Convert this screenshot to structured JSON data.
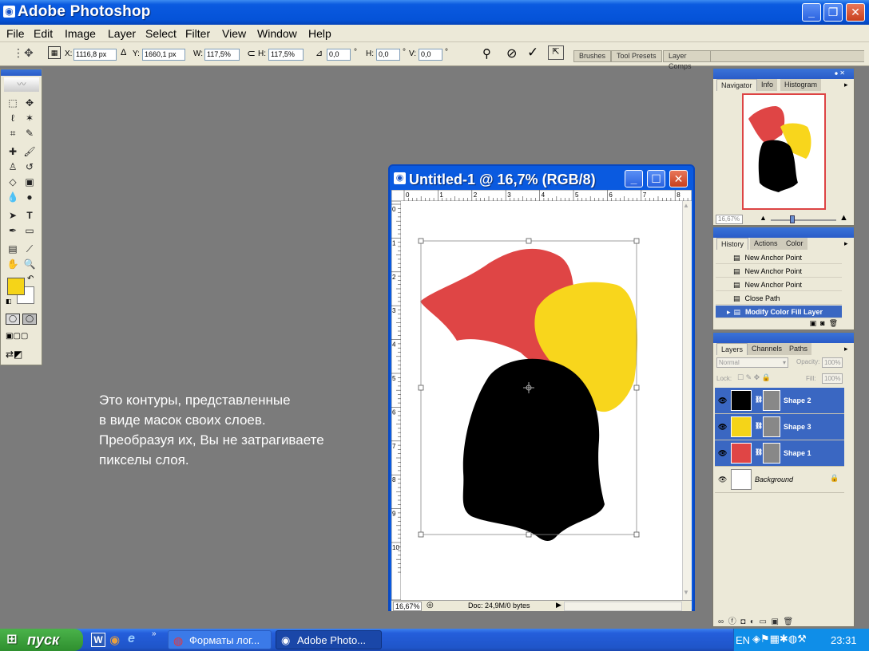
{
  "app": {
    "title": "Adobe Photoshop"
  },
  "menu": [
    "File",
    "Edit",
    "Image",
    "Layer",
    "Select",
    "Filter",
    "View",
    "Window",
    "Help"
  ],
  "options": {
    "x_label": "X:",
    "x_value": "1116,8 px",
    "y_label": "Y:",
    "y_value": "1660,1 px",
    "w_label": "W:",
    "w_value": "117,5%",
    "h_label": "H:",
    "h_value": "117,5%",
    "angle_value": "0,0",
    "hskew_label": "H:",
    "hskew_value": "0,0",
    "vskew_label": "V:",
    "vskew_value": "0,0",
    "deg": "°"
  },
  "palette_well": [
    "Brushes",
    "Tool Presets",
    "Layer Comps"
  ],
  "description": [
    "Это контуры, представленные",
    "в виде масок своих слоев.",
    "Преобразуя их, Вы не затрагиваете",
    "пикселы слоя."
  ],
  "document": {
    "title": "Untitled-1 @ 16,7% (RGB/8)",
    "zoom": "16,67%",
    "doc_info": "Doc: 24,9M/0 bytes",
    "ruler_h": [
      "0",
      "1",
      "2",
      "3",
      "4",
      "5",
      "6",
      "7",
      "8"
    ],
    "ruler_v": [
      "0",
      "1",
      "2",
      "3",
      "4",
      "5",
      "6",
      "7",
      "8",
      "9",
      "10"
    ]
  },
  "navigator": {
    "tabs": [
      "Navigator",
      "Info",
      "Histogram"
    ],
    "zoom": "16,67%"
  },
  "history": {
    "tabs": [
      "History",
      "Actions",
      "Color"
    ],
    "items": [
      "New Anchor Point",
      "New Anchor Point",
      "New Anchor Point",
      "Close Path",
      "Modify Color Fill Layer"
    ]
  },
  "layers": {
    "tabs": [
      "Layers",
      "Channels",
      "Paths"
    ],
    "blend_mode": "Normal",
    "opacity_label": "Opacity:",
    "opacity": "100%",
    "lock_label": "Lock:",
    "fill_label": "Fill:",
    "fill": "100%",
    "items": [
      {
        "name": "Shape 2",
        "color": "#000000"
      },
      {
        "name": "Shape 3",
        "color": "#f5d418"
      },
      {
        "name": "Shape 1",
        "color": "#e04545"
      },
      {
        "name": "Background",
        "color": "#ffffff"
      }
    ]
  },
  "colors": {
    "foreground": "#f5d418",
    "background": "#ffffff",
    "shape_red": "#df4545",
    "shape_yellow": "#f8d61c",
    "shape_black": "#000000"
  },
  "taskbar": {
    "start": "пуск",
    "tasks": [
      "Форматы лог...",
      "Adobe Photo..."
    ],
    "lang": "EN",
    "time": "23:31"
  }
}
